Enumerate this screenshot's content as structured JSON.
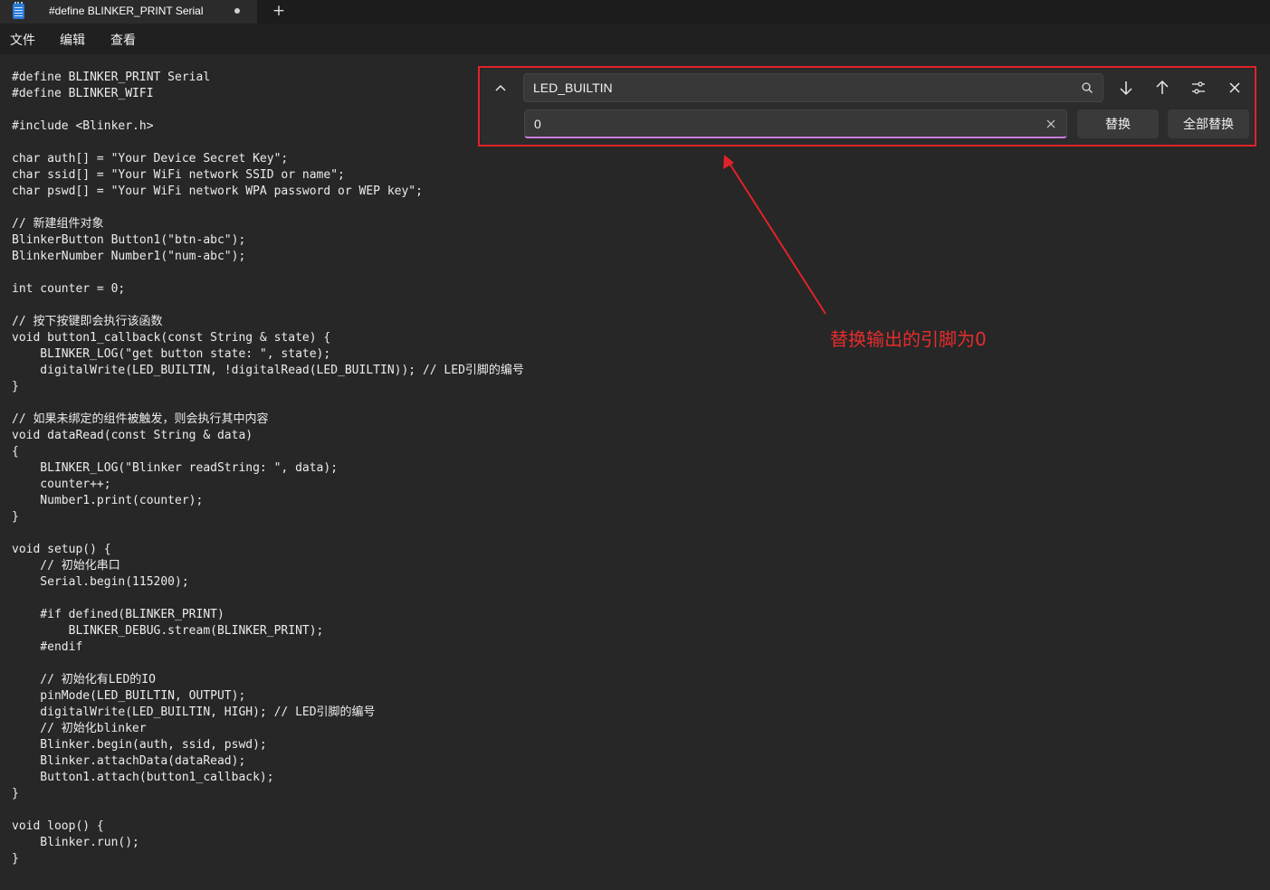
{
  "tab": {
    "title": "#define BLINKER_PRINT Serial",
    "new_tab_symbol": "+"
  },
  "menu": [
    "文件",
    "编辑",
    "查看"
  ],
  "find_replace": {
    "find_value": "LED_BUILTIN",
    "replace_value": "0",
    "replace_label": "替换",
    "replace_all_label": "全部替换"
  },
  "annotation": {
    "text": "替换输出的引脚为0",
    "color": "#e52c2c"
  },
  "code_lines": [
    "#define BLINKER_PRINT Serial",
    "#define BLINKER_WIFI",
    "",
    "#include <Blinker.h>",
    "",
    "char auth[] = \"Your Device Secret Key\";",
    "char ssid[] = \"Your WiFi network SSID or name\";",
    "char pswd[] = \"Your WiFi network WPA password or WEP key\";",
    "",
    "// 新建组件对象",
    "BlinkerButton Button1(\"btn-abc\");",
    "BlinkerNumber Number1(\"num-abc\");",
    "",
    "int counter = 0;",
    "",
    "// 按下按键即会执行该函数",
    "void button1_callback(const String & state) {",
    "    BLINKER_LOG(\"get button state: \", state);",
    "    digitalWrite(LED_BUILTIN, !digitalRead(LED_BUILTIN)); // LED引脚的编号",
    "}",
    "",
    "// 如果未绑定的组件被触发，则会执行其中内容",
    "void dataRead(const String & data)",
    "{",
    "    BLINKER_LOG(\"Blinker readString: \", data);",
    "    counter++;",
    "    Number1.print(counter);",
    "}",
    "",
    "void setup() {",
    "    // 初始化串口",
    "    Serial.begin(115200);",
    "",
    "    #if defined(BLINKER_PRINT)",
    "        BLINKER_DEBUG.stream(BLINKER_PRINT);",
    "    #endif",
    "",
    "    // 初始化有LED的IO",
    "    pinMode(LED_BUILTIN, OUTPUT);",
    "    digitalWrite(LED_BUILTIN, HIGH); // LED引脚的编号",
    "    // 初始化blinker",
    "    Blinker.begin(auth, ssid, pswd);",
    "    Blinker.attachData(dataRead);",
    "    Button1.attach(button1_callback);",
    "}",
    "",
    "void loop() {",
    "    Blinker.run();",
    "}"
  ]
}
